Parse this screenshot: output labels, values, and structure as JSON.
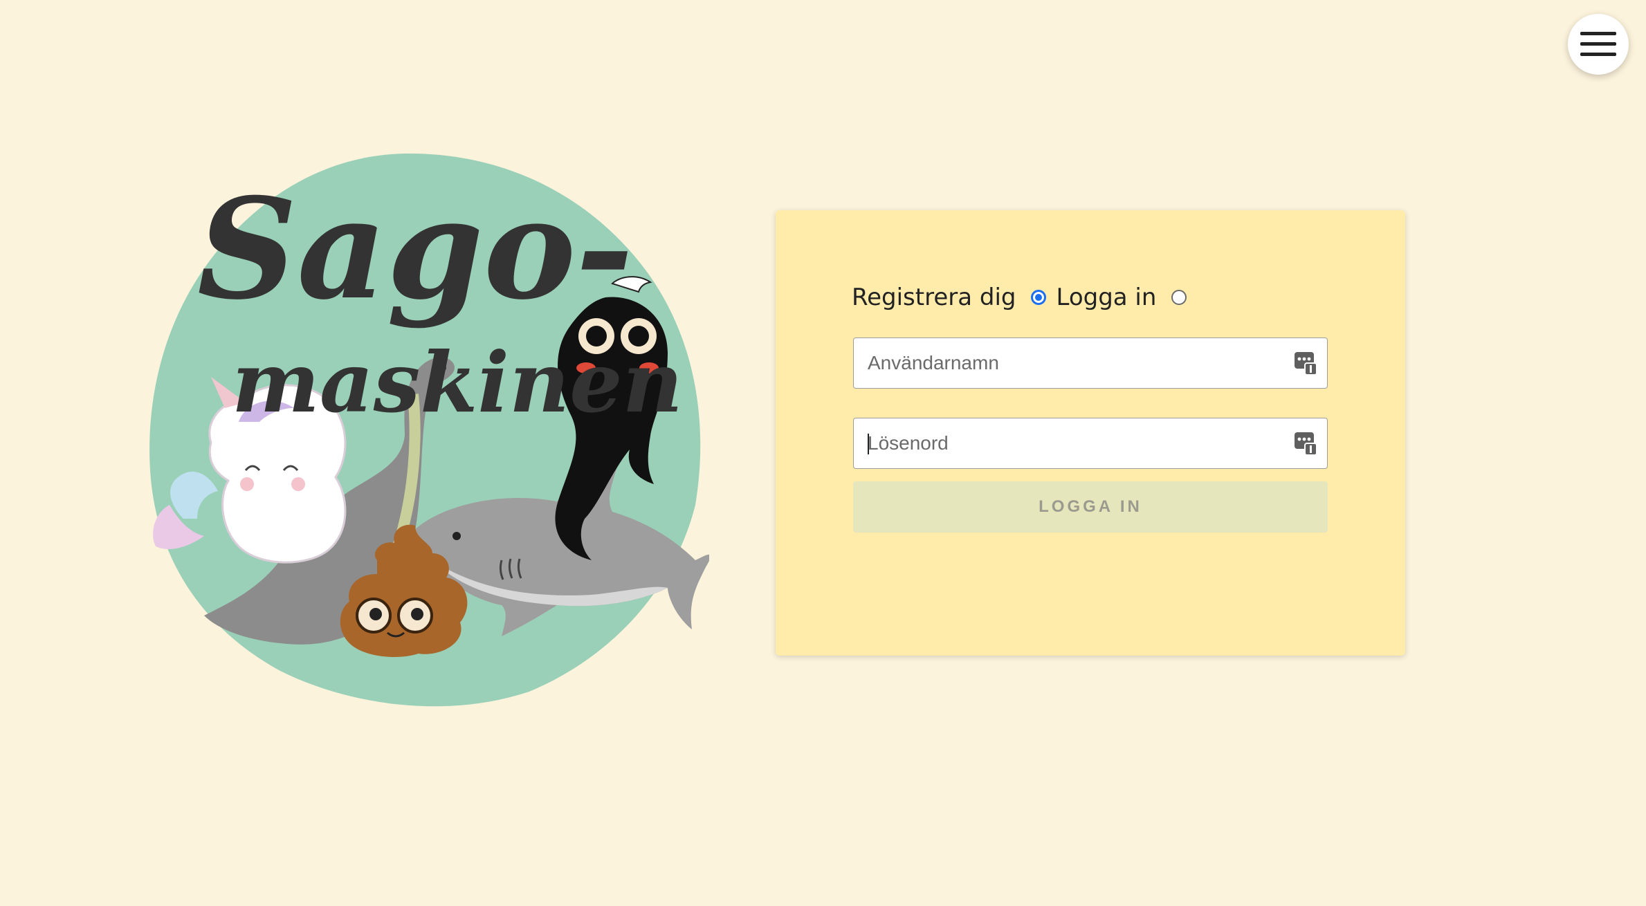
{
  "hero": {
    "logo_line1": "Sago-",
    "logo_line2": "maskinen"
  },
  "menu": {
    "icon": "hamburger-icon"
  },
  "auth": {
    "modes": [
      {
        "label": "Registrera dig",
        "selected": true
      },
      {
        "label": "Logga in",
        "selected": false
      }
    ],
    "username_placeholder": "Användarnamn",
    "password_placeholder": "Lösenord",
    "submit_label": "LOGGA IN",
    "field_icon": "password-manager-icon"
  },
  "colors": {
    "background": "#fcf3dc",
    "card": "#ffecab",
    "blob": "#9acfb8",
    "radio_accent": "#1a6ef2",
    "button_disabled": "#e6e6bd"
  }
}
